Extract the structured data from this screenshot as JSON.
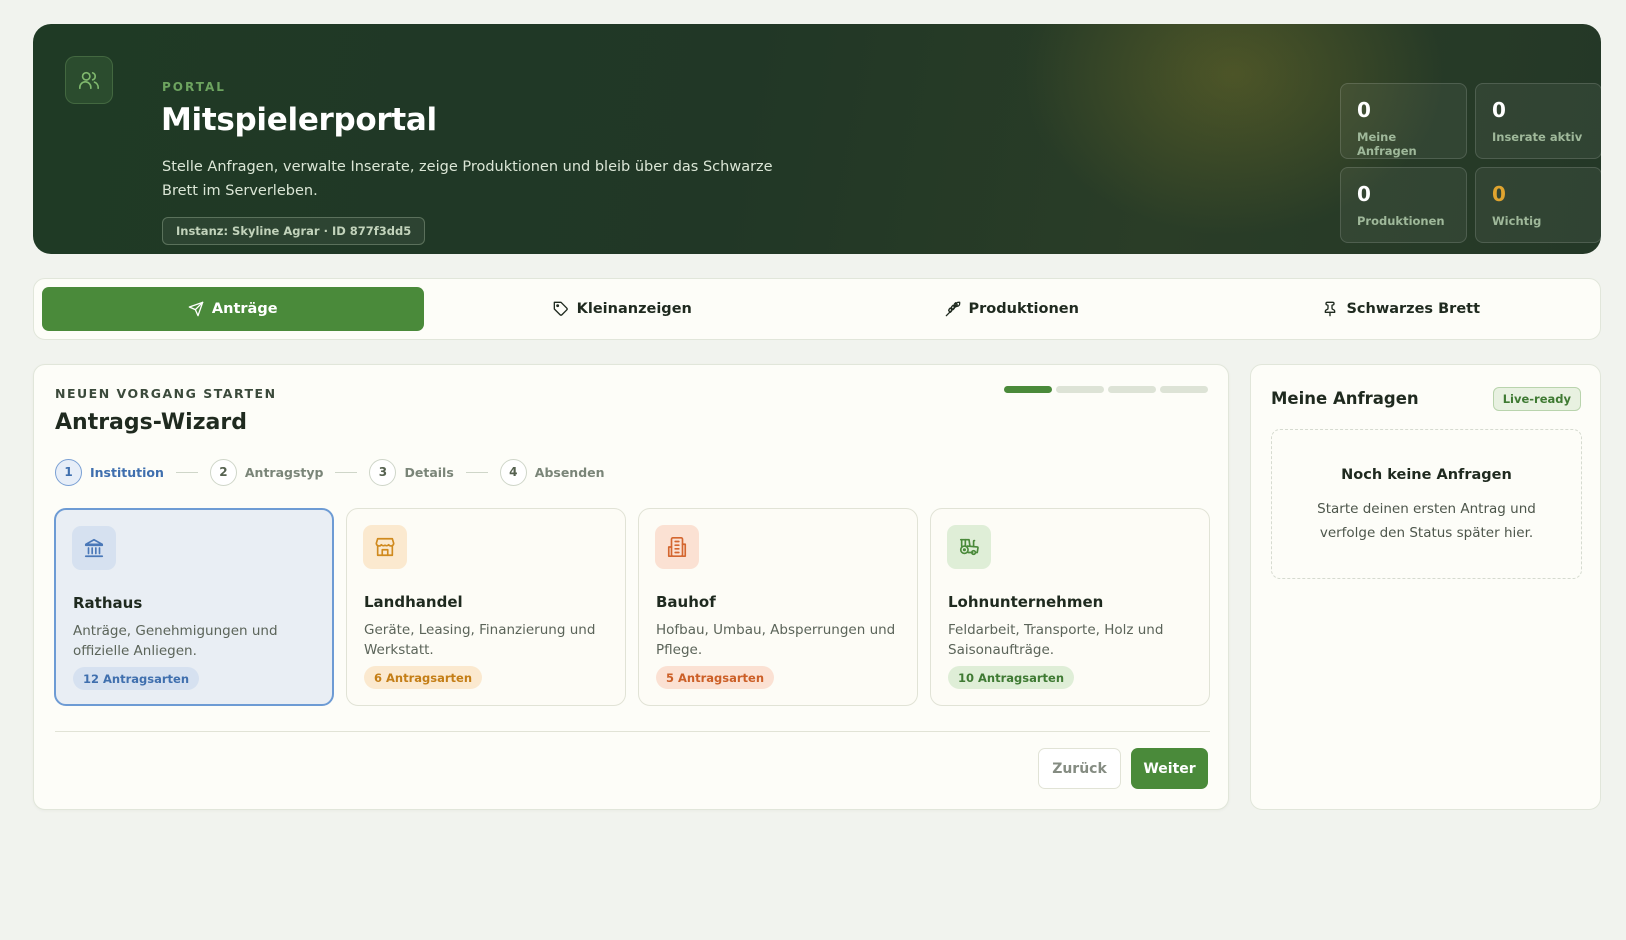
{
  "header": {
    "eyebrow": "PORTAL",
    "title": "Mitspielerportal",
    "description": "Stelle Anfragen, verwalte Inserate, zeige Produktionen und bleib über das Schwarze Brett im Serverleben.",
    "instance": "Instanz: Skyline Agrar · ID 877f3dd5",
    "icon": "users-icon",
    "stats": [
      {
        "value": "0",
        "label": "Meine Anfragen"
      },
      {
        "value": "0",
        "label": "Inserate aktiv"
      },
      {
        "value": "0",
        "label": "Produktionen"
      },
      {
        "value": "0",
        "label": "Wichtig",
        "color": "#e0a42f"
      }
    ]
  },
  "tabs": [
    {
      "label": "Anträge",
      "icon": "send-icon",
      "active": true
    },
    {
      "label": "Kleinanzeigen",
      "icon": "tag-icon"
    },
    {
      "label": "Produktionen",
      "icon": "wheat-icon"
    },
    {
      "label": "Schwarzes Brett",
      "icon": "pin-icon"
    }
  ],
  "wizard": {
    "eyebrow": "NEUEN VORGANG STARTEN",
    "title": "Antrags-Wizard",
    "progress_step": 1,
    "progress_total": 4,
    "steps": [
      {
        "num": "1",
        "label": "Institution"
      },
      {
        "num": "2",
        "label": "Antragstyp"
      },
      {
        "num": "3",
        "label": "Details"
      },
      {
        "num": "4",
        "label": "Absenden"
      }
    ],
    "cards": [
      {
        "title": "Rathaus",
        "description": "Anträge, Genehmigungen und offizielle Anliegen.",
        "badge": "12 Antragsarten",
        "icon": "building-columns-icon",
        "accent": "#3f6fae",
        "selected": true
      },
      {
        "title": "Landhandel",
        "description": "Geräte, Leasing, Finanzierung und Werkstatt.",
        "badge": "6 Antragsarten",
        "icon": "store-icon",
        "accent": "#d08a1e"
      },
      {
        "title": "Bauhof",
        "description": "Hofbau, Umbau, Absperrungen und Pflege.",
        "badge": "5 Antragsarten",
        "icon": "office-building-icon",
        "accent": "#d4662f"
      },
      {
        "title": "Lohnunternehmen",
        "description": "Feldarbeit, Transporte, Holz und Saisonaufträge.",
        "badge": "10 Antragsarten",
        "icon": "tractor-icon",
        "accent": "#4a8a3a"
      }
    ],
    "back_label": "Zurück",
    "next_label": "Weiter"
  },
  "sidebar": {
    "title": "Meine Anfragen",
    "badge": "Live-ready",
    "empty_title": "Noch keine Anfragen",
    "empty_text": "Starte deinen ersten Antrag und verfolge den Status später hier."
  }
}
